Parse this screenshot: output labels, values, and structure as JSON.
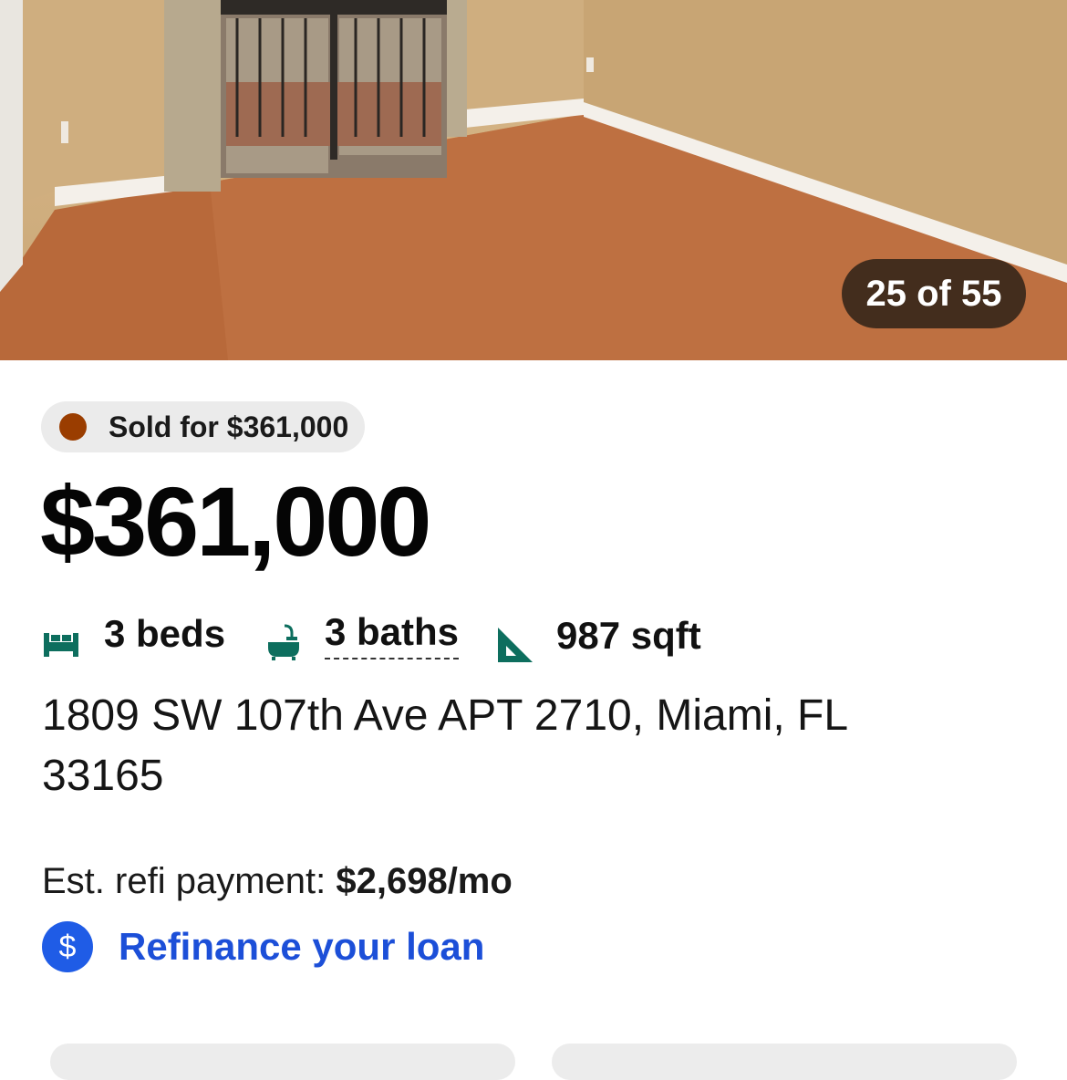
{
  "photo": {
    "counter": "25 of 55"
  },
  "listing": {
    "status_label": "Sold for $361,000",
    "status_color": "#9a3d00",
    "price": "$361,000",
    "beds": "3 beds",
    "baths": "3 baths",
    "sqft": "987 sqft",
    "icon_color": "#0d6e5e",
    "address": "1809 SW 107th Ave APT 2710, Miami, FL 33165"
  },
  "payment": {
    "label": "Est. refi payment: ",
    "amount": "$2,698/mo"
  },
  "refinance": {
    "icon_glyph": "$",
    "link_label": "Refinance your loan",
    "link_color": "#1c4fd8"
  }
}
